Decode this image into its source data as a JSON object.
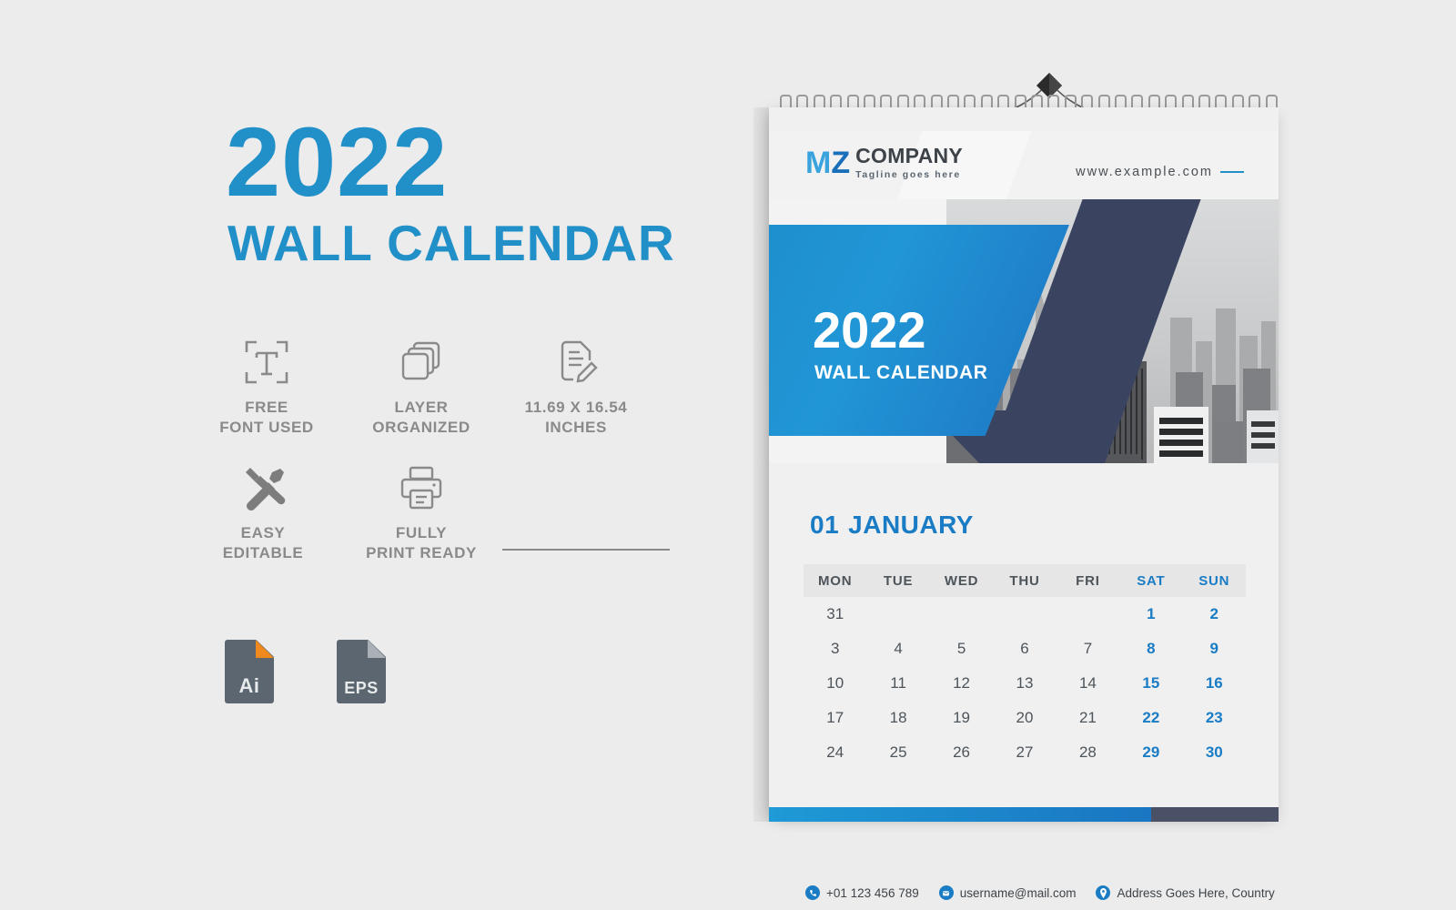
{
  "promo": {
    "year": "2022",
    "subtitle": "WALL CALENDAR",
    "features": [
      {
        "icon": "text-frame-icon",
        "line1": "FREE",
        "line2": "FONT USED"
      },
      {
        "icon": "layers-icon",
        "line1": "LAYER",
        "line2": "ORGANIZED"
      },
      {
        "icon": "document-edit-icon",
        "line1": "11.69 X 16.54",
        "line2": "INCHES"
      },
      {
        "icon": "tools-icon",
        "line1": "EASY",
        "line2": "EDITABLE"
      },
      {
        "icon": "printer-icon",
        "line1": "FULLY",
        "line2": "PRINT READY"
      }
    ],
    "file_formats": [
      {
        "label": "Ai",
        "corner_color": "#f08a1e"
      },
      {
        "label": "EPS",
        "corner_color": "#aab0b6"
      }
    ]
  },
  "calendar": {
    "logo": {
      "mark_m": "M",
      "mark_z": "Z",
      "company": "COMPANY",
      "tagline": "Tagline goes here"
    },
    "website": "www.example.com",
    "hero": {
      "year": "2022",
      "subtitle": "WALL CALENDAR",
      "photo_alt": "city-skyline-photo"
    },
    "month": {
      "number": "01",
      "name": "JANUARY"
    },
    "weekdays": [
      "MON",
      "TUE",
      "WED",
      "THU",
      "FRI",
      "SAT",
      "SUN"
    ],
    "weeks": [
      [
        "31",
        "",
        "",
        "",
        "",
        "1",
        "2"
      ],
      [
        "3",
        "4",
        "5",
        "6",
        "7",
        "8",
        "9"
      ],
      [
        "10",
        "11",
        "12",
        "13",
        "14",
        "15",
        "16"
      ],
      [
        "17",
        "18",
        "19",
        "20",
        "21",
        "22",
        "23"
      ],
      [
        "24",
        "25",
        "26",
        "27",
        "28",
        "29",
        "30"
      ]
    ],
    "contact": {
      "phone": "+01 123 456 789",
      "email": "username@mail.com",
      "address": "Address Goes Here, Country"
    }
  },
  "colors": {
    "accent_blue": "#2190c8",
    "deep_blue": "#1a7cc4",
    "navy": "#3a4461",
    "gray_text": "#8a8a8a",
    "page_bg": "#ececec"
  }
}
